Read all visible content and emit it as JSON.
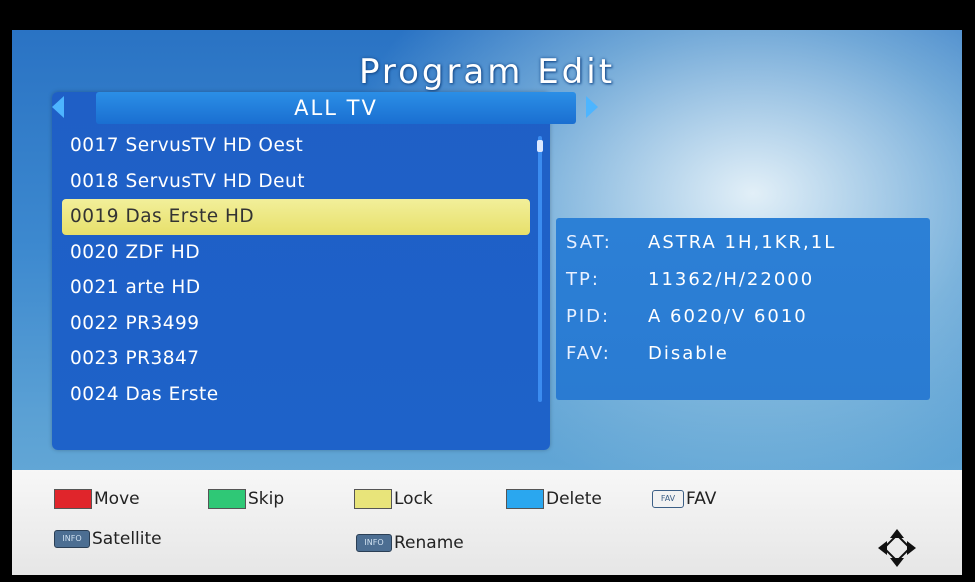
{
  "screen": {
    "title": "Program Edit"
  },
  "group": {
    "label": "ALL TV"
  },
  "channels": [
    "0017 ServusTV HD Oest",
    "0018 ServusTV HD Deut",
    "0019 Das Erste HD",
    "0020 ZDF HD",
    "0021 arte HD",
    "0022 PR3499",
    "0023 PR3847",
    "0024 Das Erste"
  ],
  "selected_index": 2,
  "info": {
    "sat_label": "SAT:",
    "sat_value": "ASTRA 1H,1KR,1L",
    "tp_label": "TP:",
    "tp_value": "11362/H/22000",
    "pid_label": "PID:",
    "pid_value": "A 6020/V 6010",
    "fav_label": "FAV:",
    "fav_value": "Disable"
  },
  "footer": {
    "move": "Move",
    "skip": "Skip",
    "lock": "Lock",
    "delete": "Delete",
    "fav": "FAV",
    "fav_icon": "FAV",
    "satellite": "Satellite",
    "satellite_icon": "INFO",
    "rename": "Rename",
    "rename_icon": "INFO"
  },
  "colors": {
    "red": "#e0252b",
    "green": "#2fc876",
    "yellow": "#e8e47a",
    "blue": "#2aa7ef"
  },
  "icons": {
    "group_prev": "triangle-left-icon",
    "group_next": "triangle-right-icon",
    "navigation": "four-way-arrow-icon"
  }
}
